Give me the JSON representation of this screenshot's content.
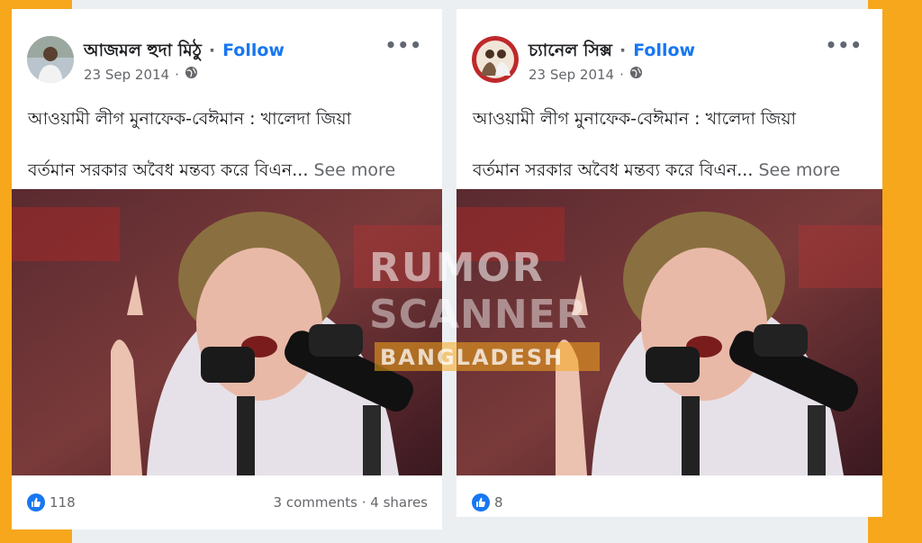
{
  "posts": [
    {
      "author": "আজমল হুদা মিঠু",
      "follow_label": "Follow",
      "date": "23 Sep 2014",
      "separator": "·",
      "text_line1": "আওয়ামী লীগ মুনাফেক-বেঈমান : খালেদা জিয়া",
      "text_line2": "বর্তমান সরকার অবৈধ মন্তব্য করে বিএন...",
      "see_more": "See more",
      "likes": "118",
      "comments": "3 comments",
      "shares": "4 shares",
      "more_icon": "more-horizontal-icon",
      "privacy_icon": "globe-icon",
      "like_icon": "like-thumb-icon"
    },
    {
      "author": "চ্যানেল সিক্স",
      "follow_label": "Follow",
      "date": "23 Sep 2014",
      "separator": "·",
      "text_line1": "আওয়ামী লীগ মুনাফেক-বেঈমান : খালেদা জিয়া",
      "text_line2": "বর্তমান সরকার অবৈধ মন্তব্য করে বিএন...",
      "see_more": "See more",
      "likes": "8",
      "more_icon": "more-horizontal-icon",
      "privacy_icon": "globe-icon",
      "like_icon": "like-thumb-icon"
    }
  ],
  "watermark": {
    "line1": "RUMOR",
    "line2": "SCANNER",
    "line3": "BANGLADESH"
  },
  "colors": {
    "accent_frame": "#f6a71b",
    "follow_blue": "#1877f2"
  }
}
